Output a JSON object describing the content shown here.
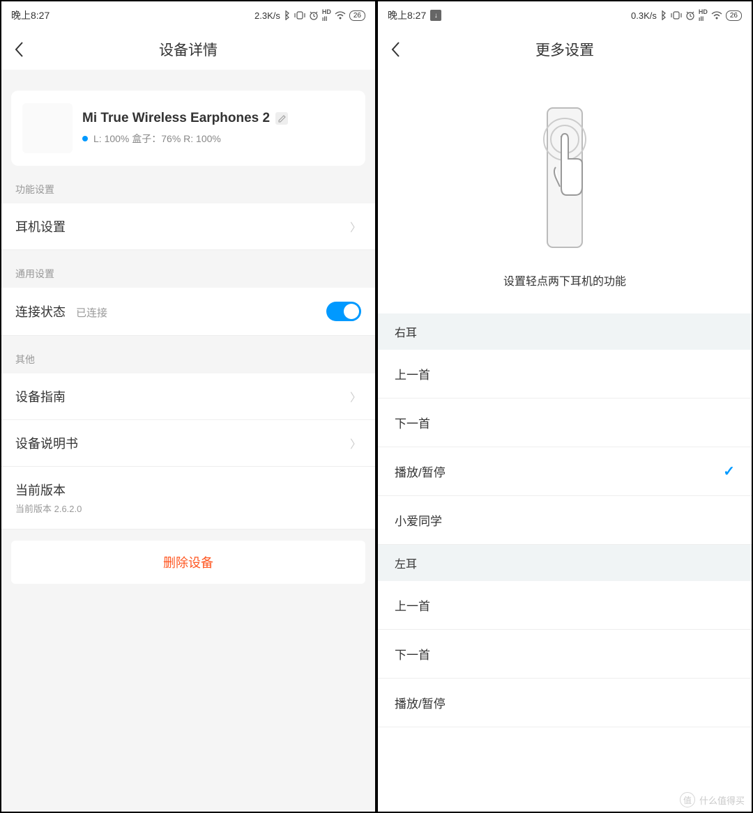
{
  "left": {
    "status": {
      "time": "晚上8:27",
      "net": "2.3K/s",
      "battery": "26"
    },
    "nav": {
      "title": "设备详情"
    },
    "device": {
      "name": "Mi True Wireless Earphones 2",
      "status": "L: 100%  盒子：76%  R: 100%"
    },
    "sections": {
      "func_header": "功能设置",
      "earphone_settings": "耳机设置",
      "general_header": "通用设置",
      "conn_label": "连接状态",
      "conn_value": "已连接",
      "other_header": "其他",
      "guide": "设备指南",
      "manual": "设备说明书",
      "version_label": "当前版本",
      "version_value": "当前版本 2.6.2.0"
    },
    "delete": "删除设备"
  },
  "right": {
    "status": {
      "time": "晚上8:27",
      "net": "0.3K/s",
      "battery": "26"
    },
    "nav": {
      "title": "更多设置"
    },
    "caption": "设置轻点两下耳机的功能",
    "groups": {
      "right_ear": "右耳",
      "left_ear": "左耳"
    },
    "options": {
      "prev": "上一首",
      "next": "下一首",
      "play_pause": "播放/暂停",
      "xiaoai": "小爱同学"
    }
  },
  "watermark": "什么值得买"
}
